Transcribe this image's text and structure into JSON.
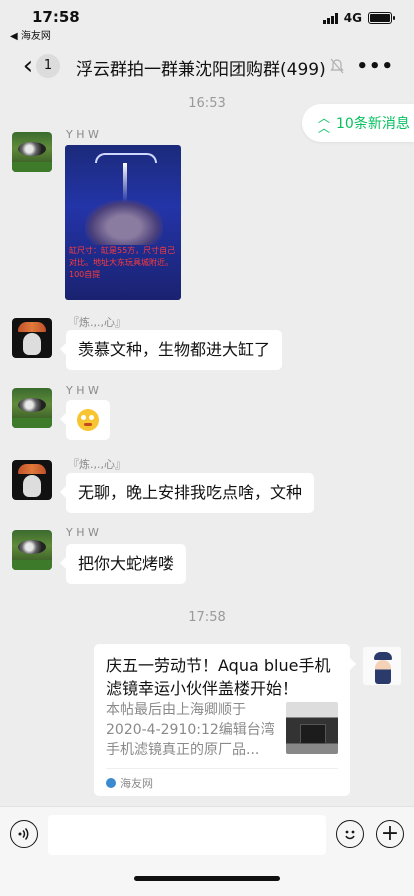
{
  "status": {
    "time": "17:58",
    "back_app": "◀ 海友网",
    "network": "4G"
  },
  "nav": {
    "back_badge": "1",
    "title": "浮云群拍一群兼沈阳团购群(499)",
    "more": "•••"
  },
  "new_messages": "10条新消息",
  "timestamps": [
    "16:53",
    "17:58"
  ],
  "messages": [
    {
      "sender": "Y H W",
      "kind": "image",
      "caption": "缸尺寸：缸是55方，尺寸自己对比。地址大东玩具城附近。100自提"
    },
    {
      "sender": "『炼.,.,心』",
      "kind": "text",
      "text": "羡慕文种，生物都进大缸了"
    },
    {
      "sender": "Y H W",
      "kind": "emoji",
      "icon": "grimace-emoji"
    },
    {
      "sender": "『炼.,.,心』",
      "kind": "text",
      "text": "无聊，晚上安排我吃点啥，文种"
    },
    {
      "sender": "Y H W",
      "kind": "text",
      "text": "把你大蛇烤喽"
    }
  ],
  "card": {
    "title": "庆五一劳动节！Aqua blue手机滤镜幸运小伙伴盖楼开始！",
    "desc": "本帖最后由上海卿顺于2020-4-2910:12编辑台湾手机滤镜真正的原厂品...",
    "source": "海友网"
  },
  "input": {
    "placeholder": ""
  }
}
